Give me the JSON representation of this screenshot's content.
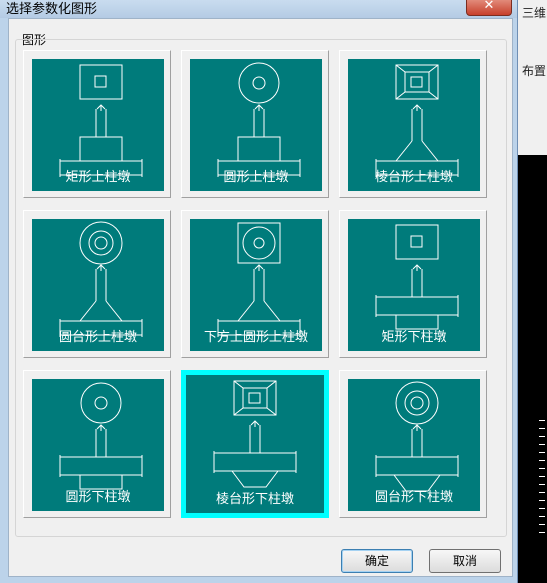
{
  "dialog": {
    "title": "选择参数化图形",
    "close_label": "✕",
    "group_label": "图形",
    "ok_label": "确定",
    "cancel_label": "取消",
    "tile_color": "#007b7b",
    "selected_color": "#00ffff"
  },
  "background_app": {
    "label_1": "三维",
    "label_2": "布置"
  },
  "shapes": [
    {
      "label": "矩形上柱墩",
      "top": "square",
      "base": "rect",
      "selected": false
    },
    {
      "label": "圆形上柱墩",
      "top": "circle",
      "base": "rect",
      "selected": false
    },
    {
      "label": "棱台形上柱墩",
      "top": "frustum",
      "base": "trap",
      "selected": false
    },
    {
      "label": "圆台形上柱墩",
      "top": "ring",
      "base": "trap",
      "selected": false
    },
    {
      "label": "下方上圆形上柱墩",
      "top": "squarecircle",
      "base": "trap",
      "selected": false
    },
    {
      "label": "矩形下柱墩",
      "top": "square",
      "base": "rect-down",
      "selected": false
    },
    {
      "label": "圆形下柱墩",
      "top": "circle",
      "base": "rect-down",
      "selected": false
    },
    {
      "label": "棱台形下柱墩",
      "top": "frustum",
      "base": "trap-down",
      "selected": true
    },
    {
      "label": "圆台形下柱墩",
      "top": "ring",
      "base": "trap-down",
      "selected": false
    }
  ]
}
